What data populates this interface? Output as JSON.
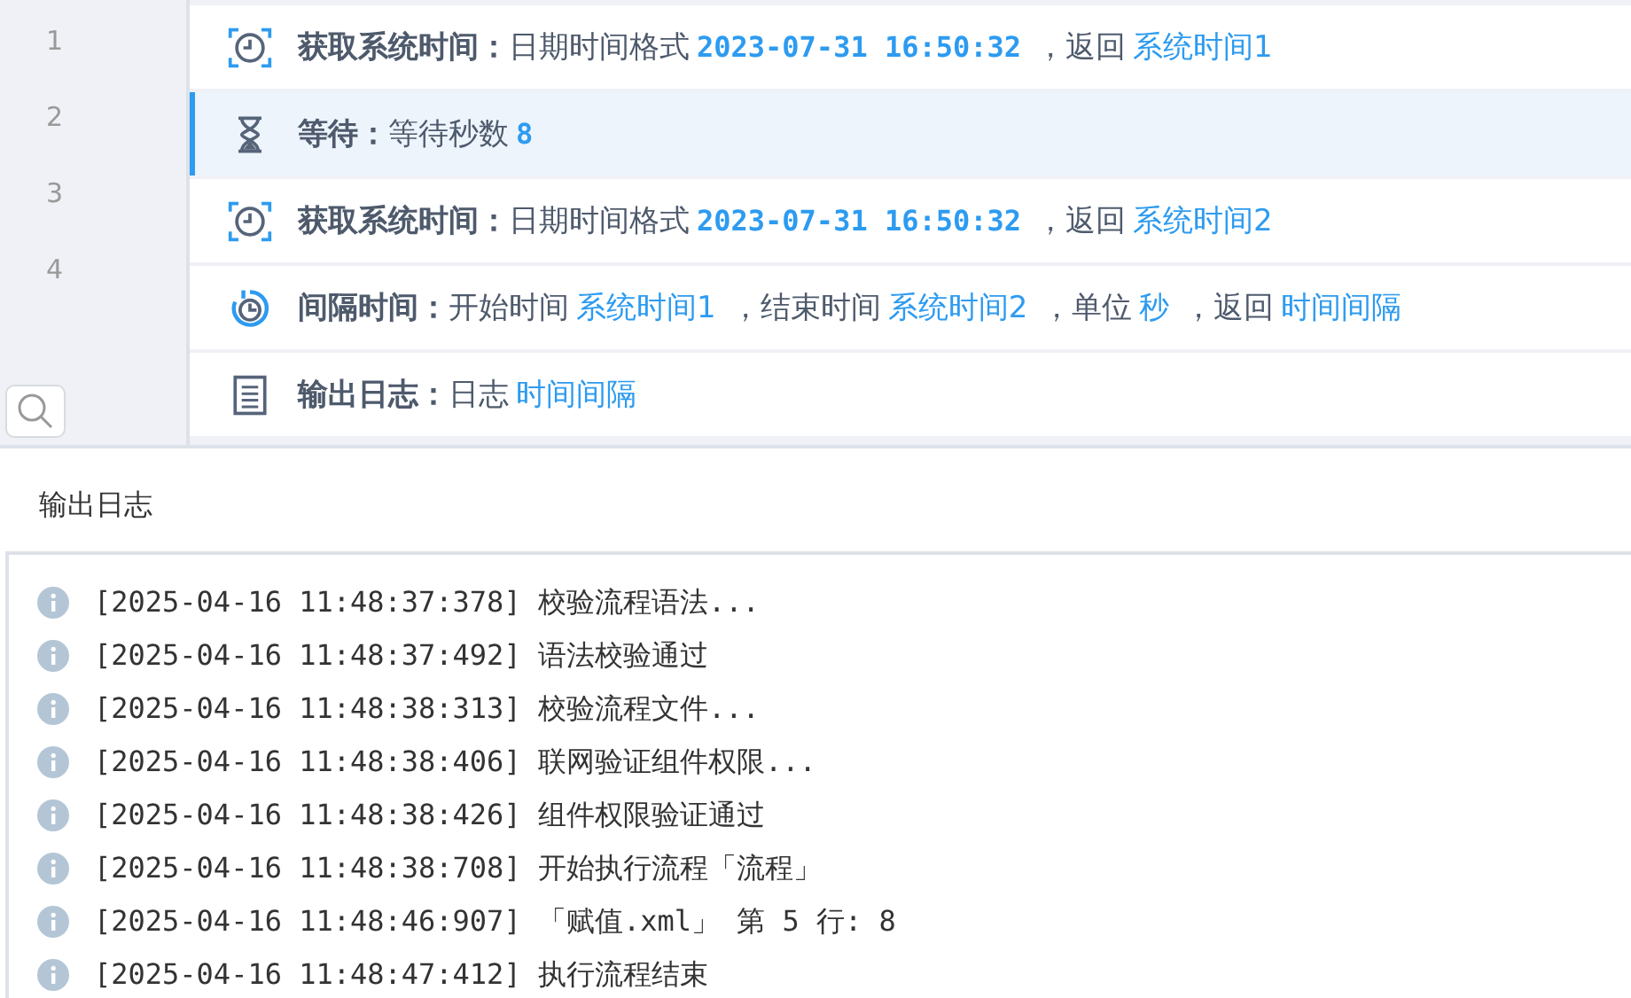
{
  "steps": [
    {
      "number": "1",
      "kind": "get-time",
      "selected": false,
      "title": "获取系统时间：",
      "parts": [
        {
          "kind": "text",
          "text": "日期时间格式"
        },
        {
          "kind": "code",
          "text": "2023-07-31 16:50:32"
        },
        {
          "kind": "text",
          "text": "，返回"
        },
        {
          "kind": "value",
          "text": "系统时间1"
        }
      ]
    },
    {
      "number": "2",
      "kind": "wait",
      "selected": true,
      "title": "等待：",
      "parts": [
        {
          "kind": "text",
          "text": "等待秒数"
        },
        {
          "kind": "code",
          "text": "8"
        }
      ]
    },
    {
      "number": "3",
      "kind": "get-time",
      "selected": false,
      "title": "获取系统时间：",
      "parts": [
        {
          "kind": "text",
          "text": "日期时间格式"
        },
        {
          "kind": "code",
          "text": "2023-07-31 16:50:32"
        },
        {
          "kind": "text",
          "text": "，返回"
        },
        {
          "kind": "value",
          "text": "系统时间2"
        }
      ]
    },
    {
      "number": "4",
      "kind": "interval",
      "selected": false,
      "title": "间隔时间：",
      "parts": [
        {
          "kind": "text",
          "text": "开始时间"
        },
        {
          "kind": "value",
          "text": "系统时间1"
        },
        {
          "kind": "text",
          "text": "，结束时间"
        },
        {
          "kind": "value",
          "text": "系统时间2"
        },
        {
          "kind": "text",
          "text": "，单位"
        },
        {
          "kind": "value",
          "text": "秒"
        },
        {
          "kind": "text",
          "text": "，返回"
        },
        {
          "kind": "value",
          "text": "时间间隔"
        }
      ]
    },
    {
      "kind": "log",
      "selected": false,
      "title": "输出日志：",
      "parts": [
        {
          "kind": "text",
          "text": "日志"
        },
        {
          "kind": "value",
          "text": "时间间隔"
        }
      ]
    }
  ],
  "log_panel": {
    "title": "输出日志",
    "lines": [
      "[2025-04-16 11:48:37:378] 校验流程语法...",
      "[2025-04-16 11:48:37:492] 语法校验通过",
      "[2025-04-16 11:48:38:313] 校验流程文件...",
      "[2025-04-16 11:48:38:406] 联网验证组件权限...",
      "[2025-04-16 11:48:38:426] 组件权限验证通过",
      "[2025-04-16 11:48:38:708] 开始执行流程「流程」",
      "[2025-04-16 11:48:46:907] 「赋值.xml」 第 5 行: 8",
      "[2025-04-16 11:48:47:412] 执行流程结束"
    ]
  }
}
